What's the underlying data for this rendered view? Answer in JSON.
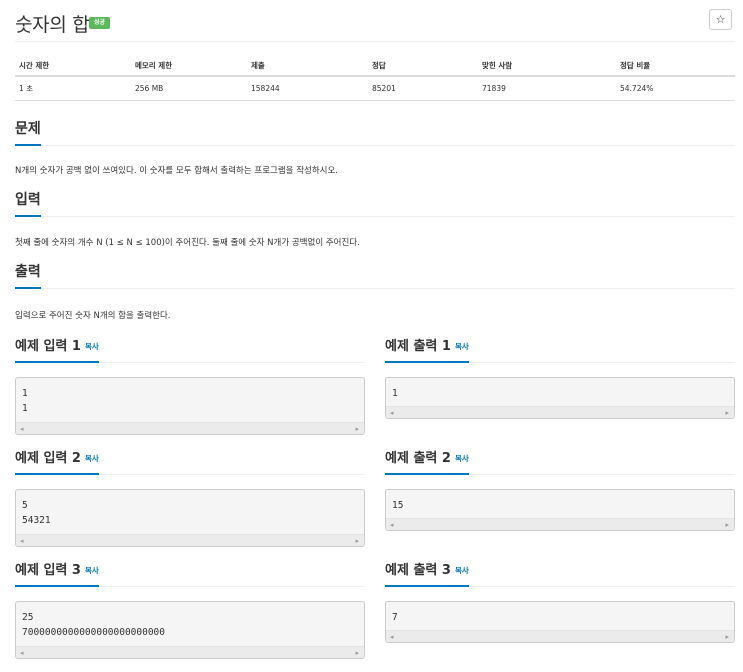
{
  "problem": {
    "title": "숫자의 합",
    "status": "성공",
    "star": "☆"
  },
  "info_table": {
    "headers": [
      "시간 제한",
      "메모리 제한",
      "제출",
      "정답",
      "맞힌 사람",
      "정답 비율"
    ],
    "values": [
      "1 초",
      "256 MB",
      "158244",
      "85201",
      "71839",
      "54.724%"
    ]
  },
  "sections": {
    "problem": {
      "title": "문제",
      "text": "N개의 숫자가 공백 없이 쓰여있다. 이 숫자를 모두 합해서 출력하는 프로그램을 작성하시오."
    },
    "input": {
      "title": "입력",
      "text": "첫째 줄에 숫자의 개수 N (1 ≤ N ≤ 100)이 주어진다. 둘째 줄에 숫자 N개가 공백없이 주어진다."
    },
    "output": {
      "title": "출력",
      "text": "입력으로 주어진 숫자 N개의 합을 출력한다."
    }
  },
  "copy_label": "복사",
  "examples": [
    {
      "input_title": "예제 입력 1",
      "input": "1\n1",
      "output_title": "예제 출력 1",
      "output": "1"
    },
    {
      "input_title": "예제 입력 2",
      "input": "5\n54321",
      "output_title": "예제 출력 2",
      "output": "15"
    },
    {
      "input_title": "예제 입력 3",
      "input": "25\n7000000000000000000000000",
      "output_title": "예제 출력 3",
      "output": "7"
    }
  ],
  "icons": {
    "scroll_left": "◂",
    "scroll_right": "▸"
  },
  "colors": {
    "accent": "#0076c0",
    "success": "#5cb85c"
  }
}
